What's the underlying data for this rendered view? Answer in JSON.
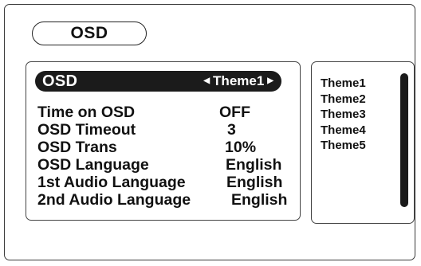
{
  "title": "OSD",
  "menu": {
    "header_label": "OSD",
    "header_value": "Theme1",
    "left_arrow": "◀",
    "right_arrow": "▶",
    "rows": [
      {
        "label": "Time on OSD",
        "value": "OFF"
      },
      {
        "label": "OSD Timeout",
        "value": "3"
      },
      {
        "label": "OSD Trans",
        "value": "10%"
      },
      {
        "label": "OSD Language",
        "value": "English"
      },
      {
        "label": "1st Audio Language",
        "value": "English"
      },
      {
        "label": "2nd Audio Language",
        "value": "English"
      }
    ]
  },
  "themes": [
    "Theme1",
    "Theme2",
    "Theme3",
    "Theme4",
    "Theme5"
  ]
}
